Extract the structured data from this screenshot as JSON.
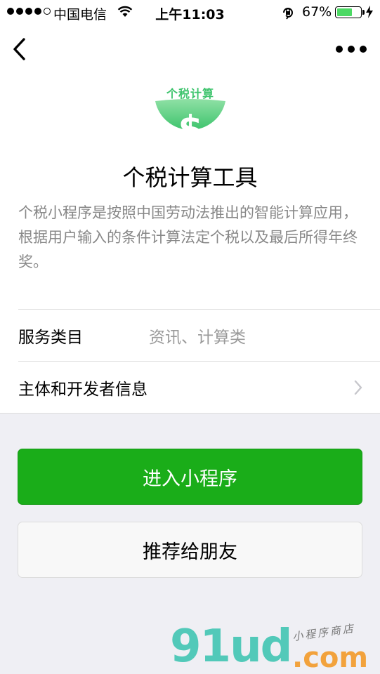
{
  "status_bar": {
    "carrier": "中国电信",
    "time": "上午11:03",
    "battery_percent": "67%",
    "battery_level": 0.67,
    "signal_bars_filled": 4,
    "signal_bars_total": 5
  },
  "app": {
    "logo_label": "个税计算",
    "title": "个税计算工具",
    "description": "个税小程序是按照中国劳动法推出的智能计算应用，根据用户输入的条件计算法定个税以及最后所得年终奖。"
  },
  "info_rows": {
    "service_category_label": "服务类目",
    "service_category_value": "资讯、计算类",
    "developer_info_label": "主体和开发者信息"
  },
  "buttons": {
    "enter_label": "进入小程序",
    "recommend_label": "推荐给朋友"
  },
  "watermark": {
    "brand": "91ud",
    "suffix": ".com",
    "tagline": "小程序商店"
  },
  "colors": {
    "primary_green": "#1aad19",
    "logo_green": "#3ec46d",
    "battery_green": "#4cd964"
  }
}
